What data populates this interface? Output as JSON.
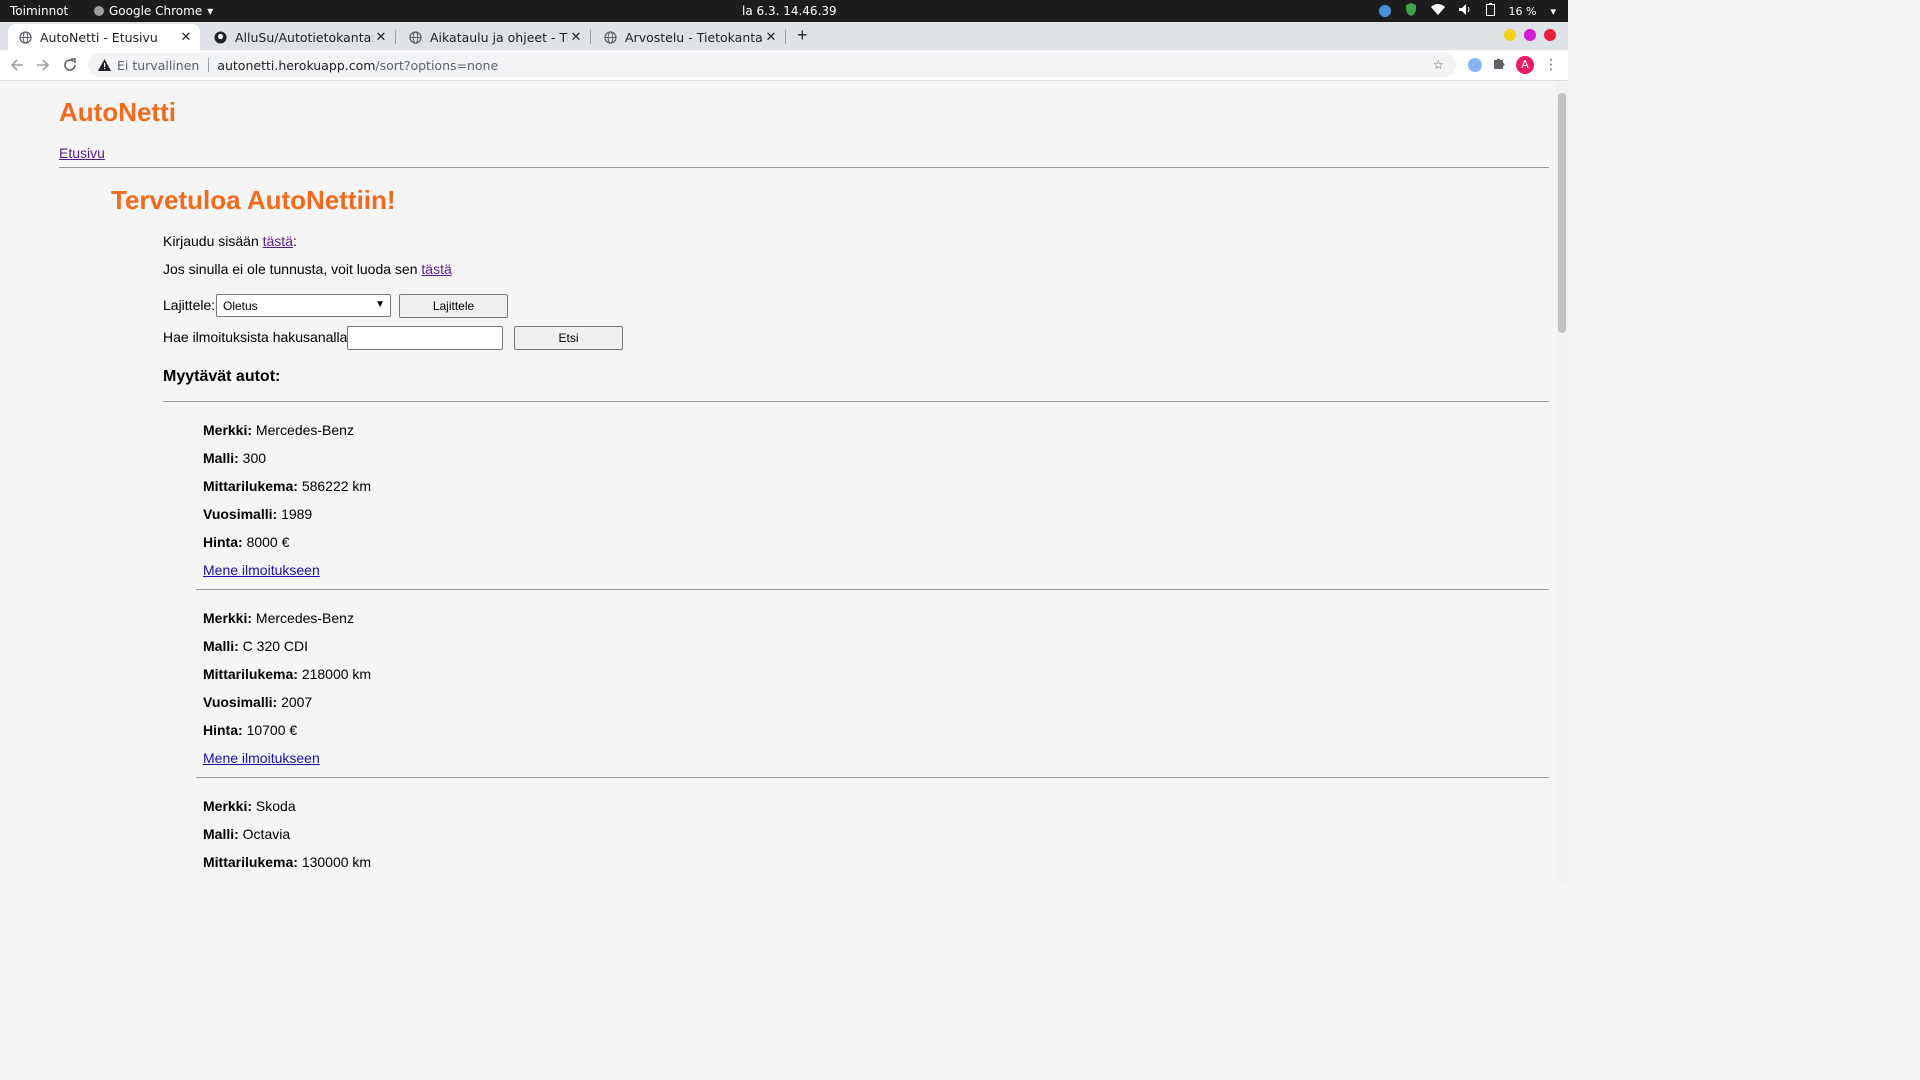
{
  "os": {
    "activities": "Toiminnot",
    "app_name": "Google Chrome",
    "clock": "la 6.3.  14.46.39",
    "battery": "16 %"
  },
  "tabs": [
    {
      "title": "AutoNetti - Etusivu",
      "active": true,
      "icon": "globe-icon"
    },
    {
      "title": "AlluSu/Autotietokanta: Ti",
      "active": false,
      "icon": "github-icon"
    },
    {
      "title": "Aikataulu ja ohjeet - Tieto",
      "active": false,
      "icon": "globe-icon"
    },
    {
      "title": "Arvostelu - Tietokantasov",
      "active": false,
      "icon": "globe-icon"
    }
  ],
  "address": {
    "security": "Ei turvallinen",
    "host": "autonetti.herokuapp.com",
    "path": "/sort?options=none"
  },
  "page": {
    "logo": "AutoNetti",
    "home_link": "Etusivu",
    "welcome": "Tervetuloa AutoNettiin!",
    "login_text": "Kirjaudu sisään ",
    "login_link": "tästä",
    "login_suffix": ":",
    "register_text": "Jos sinulla ei ole tunnusta, voit luoda sen ",
    "register_link": "tästä",
    "sort_label": "Lajittele:",
    "sort_selected": "Oletus",
    "sort_button": "Lajittele",
    "search_label": "Hae ilmoituksista hakusanalla:",
    "search_value": "",
    "search_button": "Etsi",
    "list_title": "Myytävät autot:",
    "field_labels": {
      "make": "Merkki:",
      "model": "Malli:",
      "mileage": "Mittarilukema:",
      "year": "Vuosimalli:",
      "price": "Hinta:"
    },
    "listing_link": "Mene ilmoitukseen",
    "cars": [
      {
        "make": "Mercedes-Benz",
        "model": "300",
        "mileage": "586222 km",
        "year": "1989",
        "price": "8000 €"
      },
      {
        "make": "Mercedes-Benz",
        "model": "C 320 CDI",
        "mileage": "218000 km",
        "year": "2007",
        "price": "10700 €"
      },
      {
        "make": "Skoda",
        "model": "Octavia",
        "mileage": "130000 km"
      }
    ]
  },
  "colors": {
    "brand_orange": "#f26b1d",
    "visited_link": "#551a8b",
    "link": "#1a0dab"
  }
}
